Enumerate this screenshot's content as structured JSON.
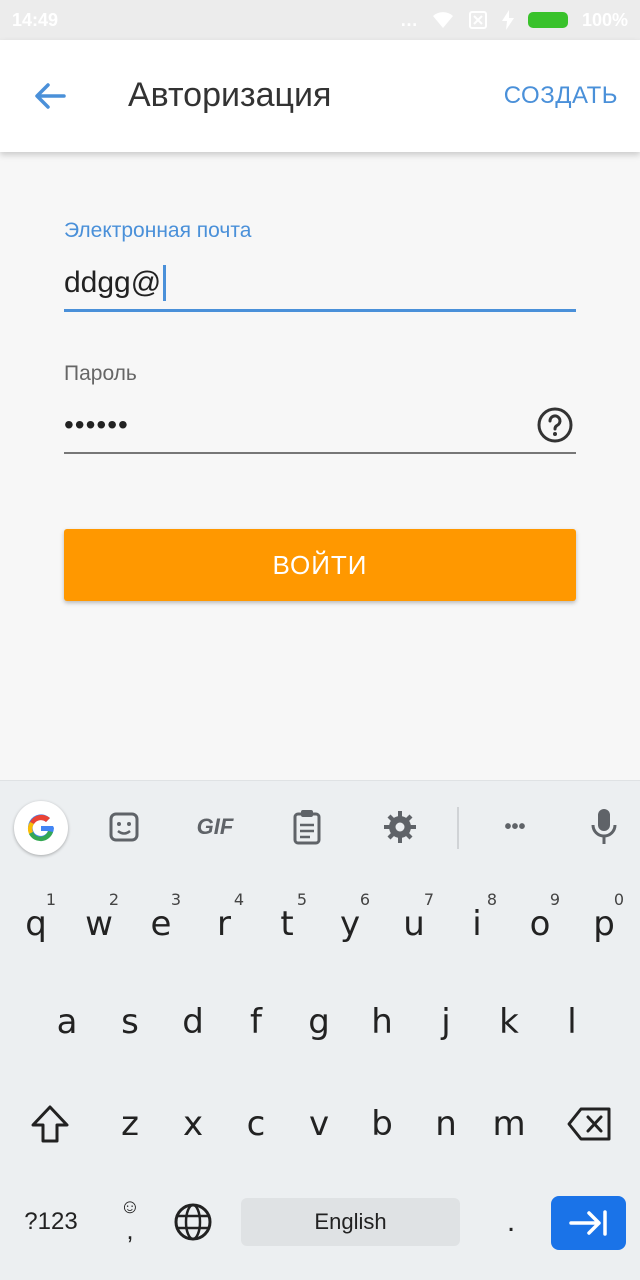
{
  "status_bar": {
    "time": "14:49",
    "battery_percent": "100%",
    "signal_icon": "signal-dots-icon",
    "wifi_icon": "wifi-icon",
    "sim_icon": "no-sim-icon",
    "charging_icon": "charging-bolt-icon"
  },
  "app_bar": {
    "title": "Авторизация",
    "create_label": "СОЗДАТЬ",
    "back_icon": "back-arrow-icon"
  },
  "form": {
    "email_label": "Электронная почта",
    "email_value": "ddgg@",
    "password_label": "Пароль",
    "password_value": "••••••",
    "help_icon": "question-circle-icon",
    "login_label": "ВОЙТИ"
  },
  "keyboard": {
    "toolbar": {
      "google_icon": "google-g-icon",
      "sticker_icon": "sticker-icon",
      "gif_label": "GIF",
      "clipboard_icon": "clipboard-icon",
      "settings_icon": "gear-icon",
      "more_label": "•••",
      "mic_icon": "microphone-icon"
    },
    "row1": [
      {
        "key": "q",
        "hint": "1"
      },
      {
        "key": "w",
        "hint": "2"
      },
      {
        "key": "e",
        "hint": "3"
      },
      {
        "key": "r",
        "hint": "4"
      },
      {
        "key": "t",
        "hint": "5"
      },
      {
        "key": "y",
        "hint": "6"
      },
      {
        "key": "u",
        "hint": "7"
      },
      {
        "key": "i",
        "hint": "8"
      },
      {
        "key": "o",
        "hint": "9"
      },
      {
        "key": "p",
        "hint": "0"
      }
    ],
    "row2": [
      "a",
      "s",
      "d",
      "f",
      "g",
      "h",
      "j",
      "k",
      "l"
    ],
    "row3": [
      "z",
      "x",
      "c",
      "v",
      "b",
      "n",
      "m"
    ],
    "shift_icon": "shift-arrow-icon",
    "backspace_icon": "backspace-icon",
    "symbols_label": "?123",
    "emoji_label": "☺",
    "comma_label": ",",
    "globe_icon": "globe-icon",
    "space_label": "English",
    "period_label": ".",
    "next_icon": "tab-next-icon"
  },
  "colors": {
    "accent_blue": "#4a90d9",
    "login_orange": "#ff9800",
    "keyboard_blue": "#1a73e8"
  }
}
